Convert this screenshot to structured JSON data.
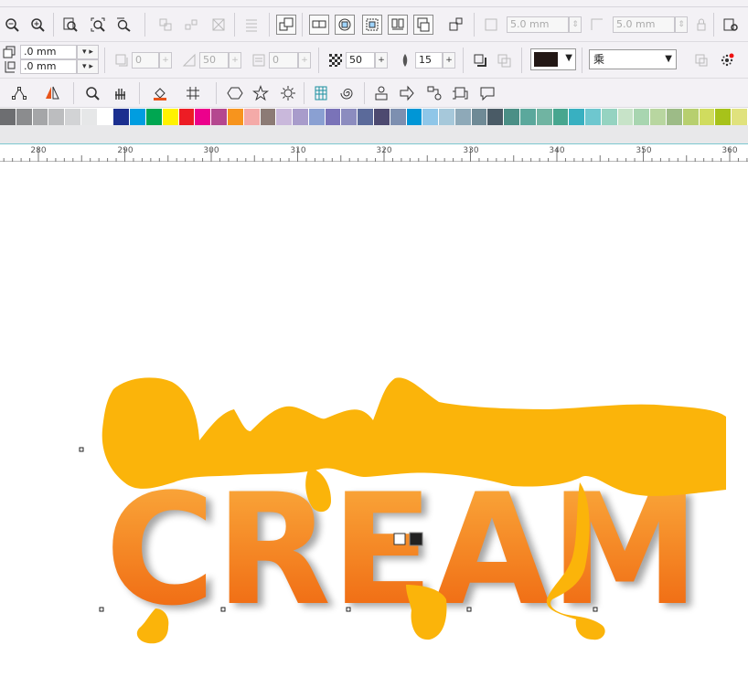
{
  "toolbar_top": {
    "object_width": "5.0 mm",
    "object_height": "5.0 mm"
  },
  "property_bar": {
    "offset_x": ".0 mm",
    "offset_y": ".0 mm",
    "shadow_angle": "0",
    "shadow_stretch": "50",
    "shadow_opacity_disabled": "0",
    "shadow_opacity": "50",
    "shadow_feather": "15",
    "shadow_color": "#231815",
    "merge_mode": "乘"
  },
  "ruler": {
    "labels": [
      "280",
      "290",
      "300",
      "310",
      "320",
      "330",
      "340",
      "350",
      "360"
    ]
  },
  "palette": {
    "colors": [
      "#6d6e71",
      "#8b8c8e",
      "#a5a6a8",
      "#bcbdbf",
      "#d2d3d5",
      "#e6e7e8",
      "#ffffff",
      "#1b2f8f",
      "#009de0",
      "#00a651",
      "#fff200",
      "#ed1c24",
      "#ec008c",
      "#b5478f",
      "#f7941d",
      "#f4aaa8",
      "#8c7b75",
      "#c9b8db",
      "#a89ccb",
      "#8aa0d2",
      "#7a73b8",
      "#8c8cbf",
      "#5b6a9a",
      "#4d4a70",
      "#7d8fb0",
      "#0096d6",
      "#8fc6e8",
      "#a6c8da",
      "#8ea9b8",
      "#6f8a96",
      "#4a5b66",
      "#4b8f86",
      "#5ba89c",
      "#70b4a2",
      "#47a68f",
      "#38b0c1",
      "#6ec7cf",
      "#95d3c1",
      "#c7e3c8",
      "#a8d5b0",
      "#b8d6a0",
      "#9dbb87",
      "#b7cf6f",
      "#d0dc5e",
      "#a7c21a",
      "#e0e27d"
    ]
  },
  "design": {
    "text": "CREAM",
    "drip_color": "#fbb40a",
    "gradient_top": "#fbb040",
    "gradient_bottom": "#ee5f0b"
  }
}
